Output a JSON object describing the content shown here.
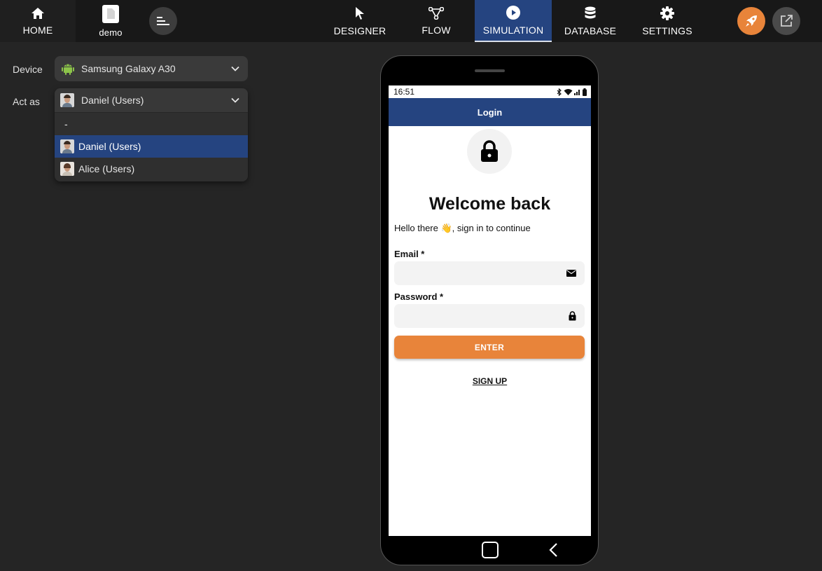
{
  "topbar": {
    "home_label": "HOME",
    "project_label": "demo",
    "tabs": [
      {
        "label": "DESIGNER",
        "icon": "cursor-icon"
      },
      {
        "label": "FLOW",
        "icon": "flow-icon"
      },
      {
        "label": "SIMULATION",
        "icon": "play-icon",
        "active": true
      },
      {
        "label": "DATABASE",
        "icon": "database-icon"
      },
      {
        "label": "SETTINGS",
        "icon": "gear-icon"
      }
    ],
    "accent_color": "#254480",
    "rocket_color": "#e8843a"
  },
  "sidebar": {
    "device_label": "Device",
    "device_value": "Samsung Galaxy A30",
    "act_as_label": "Act as",
    "act_as_value": "Daniel (Users)",
    "act_as_options": [
      "-",
      "Daniel (Users)",
      "Alice (Users)"
    ],
    "selected_option": "Daniel (Users)"
  },
  "phone": {
    "status_time": "16:51",
    "appbar_title": "Login",
    "heading": "Welcome back",
    "subtitle": "Hello there 👋, sign in to continue",
    "email_label": "Email *",
    "email_value": "",
    "password_label": "Password *",
    "password_value": "",
    "enter_label": "ENTER",
    "signup_label": "SIGN UP",
    "button_color": "#e8843a"
  }
}
